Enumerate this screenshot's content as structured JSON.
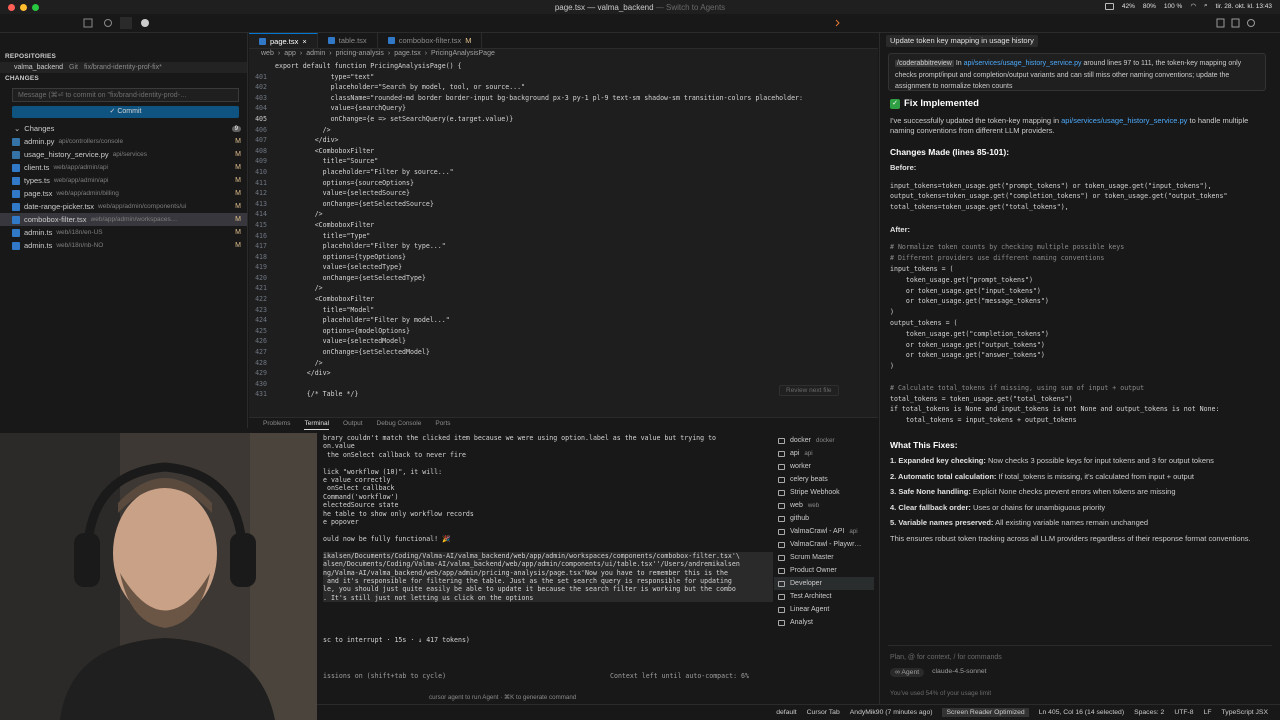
{
  "window": {
    "title": "page.tsx — valma_backend",
    "subtitle": "Switch to Agents"
  },
  "menubar": {
    "battery_a": "42%",
    "battery_b": "80%",
    "zoom": "100 %",
    "datetime": "tir. 28. okt. kl. 13:43"
  },
  "sidebar": {
    "repositories_label": "REPOSITORIES",
    "repo_name": "valma_backend",
    "repo_vcs": "Git",
    "repo_branch": "fix/brand-identity-prof-fix*",
    "changes_label": "CHANGES",
    "commit_placeholder": "Message (⌘⏎ to commit on \"fix/brand-identity-prod-…",
    "commit_button": "Commit",
    "changes_group": "Changes",
    "changes_count": "9",
    "files": [
      {
        "name": "admin.py",
        "path": "api/controllers/console",
        "status": "M",
        "color": "#3572A5"
      },
      {
        "name": "usage_history_service.py",
        "path": "api/services",
        "status": "M",
        "color": "#3572A5"
      },
      {
        "name": "client.ts",
        "path": "web/app/admin/api",
        "status": "M",
        "color": "#3178c6"
      },
      {
        "name": "types.ts",
        "path": "web/app/admin/api",
        "status": "M",
        "color": "#3178c6"
      },
      {
        "name": "page.tsx",
        "path": "web/app/admin/billing",
        "status": "M",
        "color": "#3178c6"
      },
      {
        "name": "date-range-picker.tsx",
        "path": "web/app/admin/components/ui",
        "status": "M",
        "color": "#3178c6"
      },
      {
        "name": "combobox-filter.tsx",
        "path": "web/app/admin/workspaces…",
        "status": "M",
        "color": "#3178c6"
      },
      {
        "name": "admin.ts",
        "path": "web/i18n/en-US",
        "status": "M",
        "color": "#3178c6"
      },
      {
        "name": "admin.ts",
        "path": "web/i18n/nb-NO",
        "status": "M",
        "color": "#3178c6"
      }
    ]
  },
  "editor": {
    "tabs": [
      {
        "label": "page.tsx",
        "close": "×",
        "mod": ""
      },
      {
        "label": "table.tsx",
        "close": "",
        "mod": ""
      },
      {
        "label": "combobox-filter.tsx",
        "close": "",
        "mod": "M"
      }
    ],
    "breadcrumb": [
      "web",
      "app",
      "admin",
      "pricing-analysis",
      "page.tsx",
      "PricingAnalysisPage"
    ],
    "lines": [
      {
        "n": "",
        "t": "export default function PricingAnalysisPage() {"
      },
      {
        "n": "401",
        "t": "              type=\"text\""
      },
      {
        "n": "402",
        "t": "              placeholder=\"Search by model, tool, or source...\""
      },
      {
        "n": "403",
        "t": "              className=\"rounded-md border border-input bg-background px-3 py-1 pl-9 text-sm shadow-sm transition-colors placeholder:"
      },
      {
        "n": "404",
        "t": "              value={searchQuery}"
      },
      {
        "n": "405",
        "t": "              onChange={e => setSearchQuery(e.target.value)}"
      },
      {
        "n": "406",
        "t": "            />"
      },
      {
        "n": "407",
        "t": "          </div>"
      },
      {
        "n": "408",
        "t": "          <ComboboxFilter"
      },
      {
        "n": "409",
        "t": "            title=\"Source\""
      },
      {
        "n": "410",
        "t": "            placeholder=\"Filter by source...\""
      },
      {
        "n": "411",
        "t": "            options={sourceOptions}"
      },
      {
        "n": "412",
        "t": "            value={selectedSource}"
      },
      {
        "n": "413",
        "t": "            onChange={setSelectedSource}"
      },
      {
        "n": "414",
        "t": "          />"
      },
      {
        "n": "415",
        "t": "          <ComboboxFilter"
      },
      {
        "n": "416",
        "t": "            title=\"Type\""
      },
      {
        "n": "417",
        "t": "            placeholder=\"Filter by type...\""
      },
      {
        "n": "418",
        "t": "            options={typeOptions}"
      },
      {
        "n": "419",
        "t": "            value={selectedType}"
      },
      {
        "n": "420",
        "t": "            onChange={setSelectedType}"
      },
      {
        "n": "421",
        "t": "          />"
      },
      {
        "n": "422",
        "t": "          <ComboboxFilter"
      },
      {
        "n": "423",
        "t": "            title=\"Model\""
      },
      {
        "n": "424",
        "t": "            placeholder=\"Filter by model...\""
      },
      {
        "n": "425",
        "t": "            options={modelOptions}"
      },
      {
        "n": "426",
        "t": "            value={selectedModel}"
      },
      {
        "n": "427",
        "t": "            onChange={setSelectedModel}"
      },
      {
        "n": "428",
        "t": "          />"
      },
      {
        "n": "429",
        "t": "        </div>"
      },
      {
        "n": "430",
        "t": ""
      },
      {
        "n": "431",
        "t": "        {/* Table */}"
      }
    ],
    "review_next": "Review next file"
  },
  "panel": {
    "tabs": [
      "Problems",
      "Terminal",
      "Output",
      "Debug Console",
      "Ports"
    ],
    "terminal_lines": [
      "brary couldn't match the clicked item because we were using option.label as the value but trying to",
      "on.value",
      " the onSelect callback to never fire",
      "",
      "lick \"workflow (10)\", it will:",
      "e value correctly",
      " onSelect callback",
      "Command('workflow')",
      "electedSource state",
      "he table to show only workflow records",
      "e popover",
      "",
      "ould now be fully functional! 🎉",
      "",
      "ikalsen/Documents/Coding/Valma-AI/valma_backend/web/app/admin/workspaces/components/combobox-filter.tsx'\\",
      "alsen/Documents/Coding/Valma-AI/valma_backend/web/app/admin/components/ui/table.tsx''/Users/andremikalsen",
      "ng/Valma-AI/valma_backend/web/app/admin/pricing-analysis/page.tsx'Now you have to remember this is the",
      " and it's responsible for filtering the table. Just as the set search query is responsible for updating",
      "le, you should just quite easily be able to update it because the search filter is working but the combo",
      ". It's still just not letting us click on the options",
      "",
      "",
      "",
      "",
      "sc to interrupt · 15s · ↓ 417 tokens)"
    ],
    "footer_left": "issions on (shift+tab to cycle)",
    "footer_right": "Context left until auto-compact: 6%",
    "hint": "cursor agent to run Agent · ⌘K to generate command",
    "terminals": [
      {
        "label": "docker",
        "sub": "docker"
      },
      {
        "label": "api",
        "sub": "api"
      },
      {
        "label": "worker",
        "sub": ""
      },
      {
        "label": "celery beats",
        "sub": ""
      },
      {
        "label": "Stripe Webhook",
        "sub": ""
      },
      {
        "label": "web",
        "sub": "web"
      },
      {
        "label": "github",
        "sub": ""
      },
      {
        "label": "ValmaCrawl - API",
        "sub": "api"
      },
      {
        "label": "ValmaCrawl - Playwr…",
        "sub": ""
      },
      {
        "label": "Scrum Master",
        "sub": ""
      },
      {
        "label": "Product Owner",
        "sub": ""
      },
      {
        "label": "Developer",
        "sub": ""
      },
      {
        "label": "Test Architect",
        "sub": ""
      },
      {
        "label": "Linear Agent",
        "sub": ""
      },
      {
        "label": "Analyst",
        "sub": ""
      }
    ]
  },
  "statusbar": {
    "items": [
      "default",
      "Cursor Tab",
      "AndyMik90 (7 minutes ago)",
      "Screen Reader Optimized",
      "Ln 405, Col 16 (14 selected)",
      "Spaces: 2",
      "UTF-8",
      "LF",
      "TypeScript JSX"
    ]
  },
  "agent": {
    "tab_title": "Update token key mapping in usage history",
    "msg_slash": "/coderabbitreview",
    "msg_text_a": " In ",
    "msg_link": "api/services/usage_history_service.py",
    "msg_text_b": " around lines 97 to 111, the token-key mapping only checks prompt/input and completion/output variants and can still miss other naming conventions; update the assignment to normalize token counts",
    "heading": "Fix Implemented",
    "intro_a": "I've successfully updated the token-key mapping in ",
    "intro_link": "api/services/usage_history_service.py",
    "intro_b": " to handle multiple naming conventions from different LLM providers.",
    "changes_heading": "Changes Made (lines 85-101):",
    "before_label": "Before:",
    "before_code": [
      "input_tokens=token_usage.get(\"prompt_tokens\") or token_usage.get(\"input_tokens\"),",
      "output_tokens=token_usage.get(\"completion_tokens\") or token_usage.get(\"output_tokens\"",
      "total_tokens=token_usage.get(\"total_tokens\"),"
    ],
    "after_label": "After:",
    "after_code": [
      "# Normalize token counts by checking multiple possible keys",
      "# Different providers use different naming conventions",
      "input_tokens = (",
      "    token_usage.get(\"prompt_tokens\")",
      "    or token_usage.get(\"input_tokens\")",
      "    or token_usage.get(\"message_tokens\")",
      ")",
      "output_tokens = (",
      "    token_usage.get(\"completion_tokens\")",
      "    or token_usage.get(\"output_tokens\")",
      "    or token_usage.get(\"answer_tokens\")",
      ")",
      "",
      "# Calculate total_tokens if missing, using sum of input + output",
      "total_tokens = token_usage.get(\"total_tokens\")",
      "if total_tokens is None and input_tokens is not None and output_tokens is not None:",
      "    total_tokens = input_tokens + output_tokens"
    ],
    "what_heading": "What This Fixes:",
    "fixes": [
      {
        "b": "1. Expanded key checking:",
        "t": " Now checks 3 possible keys for input tokens and 3 for output tokens"
      },
      {
        "b": "2. Automatic total calculation:",
        "t": " If total_tokens is missing, it's calculated from input + output"
      },
      {
        "b": "3. Safe None handling:",
        "t": " Explicit None checks prevent errors when tokens are missing"
      },
      {
        "b": "4. Clear fallback order:",
        "t": " Uses or chains for unambiguous priority"
      },
      {
        "b": "5. Variable names preserved:",
        "t": " All existing variable names remain unchanged"
      }
    ],
    "summary": "This ensures robust token tracking across all LLM providers regardless of their response format conventions.",
    "input_placeholder": "Plan, @ for context, / for commands",
    "mode": "Agent",
    "model": "claude-4.5-sonnet",
    "usage": "You've used 54% of your usage limit"
  }
}
